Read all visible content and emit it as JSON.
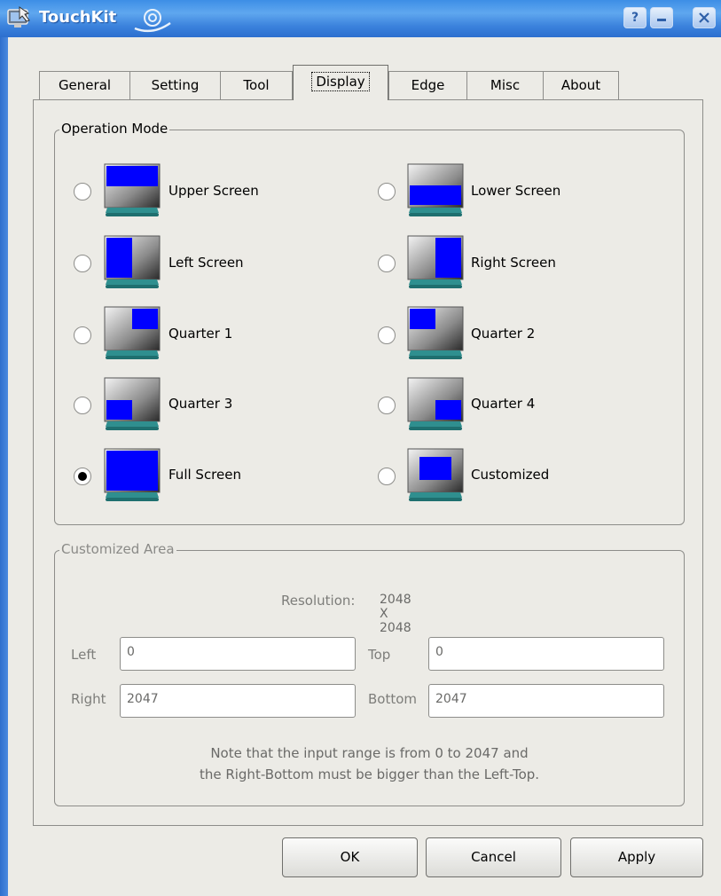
{
  "window": {
    "title": "TouchKit"
  },
  "tabs": [
    {
      "label": "General"
    },
    {
      "label": "Setting"
    },
    {
      "label": "Tool"
    },
    {
      "label": "Display"
    },
    {
      "label": "Edge"
    },
    {
      "label": "Misc"
    },
    {
      "label": "About"
    }
  ],
  "active_tab": "Display",
  "operation_mode": {
    "title": "Operation Mode",
    "selected": "Full Screen",
    "options": [
      {
        "label": "Upper Screen",
        "checked": false
      },
      {
        "label": "Lower Screen",
        "checked": false
      },
      {
        "label": "Left Screen",
        "checked": false
      },
      {
        "label": "Right Screen",
        "checked": false
      },
      {
        "label": "Quarter 1",
        "checked": false
      },
      {
        "label": "Quarter 2",
        "checked": false
      },
      {
        "label": "Quarter 3",
        "checked": false
      },
      {
        "label": "Quarter 4",
        "checked": false
      },
      {
        "label": "Full Screen",
        "checked": true
      },
      {
        "label": "Customized",
        "checked": false
      }
    ]
  },
  "customized_area": {
    "title": "Customized Area",
    "resolution_label": "Resolution:",
    "resolution_value": "2048 X 2048",
    "left_label": "Left",
    "left_value": "0",
    "top_label": "Top",
    "top_value": "0",
    "right_label": "Right",
    "right_value": "2047",
    "bottom_label": "Bottom",
    "bottom_value": "2047",
    "note_line1": "Note that the input range is from 0 to 2047 and",
    "note_line2": "the Right-Bottom must be bigger than the Left-Top."
  },
  "buttons": {
    "ok": "OK",
    "cancel": "Cancel",
    "apply": "Apply"
  },
  "colors": {
    "titlebar": "#3b82dc",
    "monitor_screen": "#0000ff",
    "monitor_stand": "#2f8f8f"
  }
}
